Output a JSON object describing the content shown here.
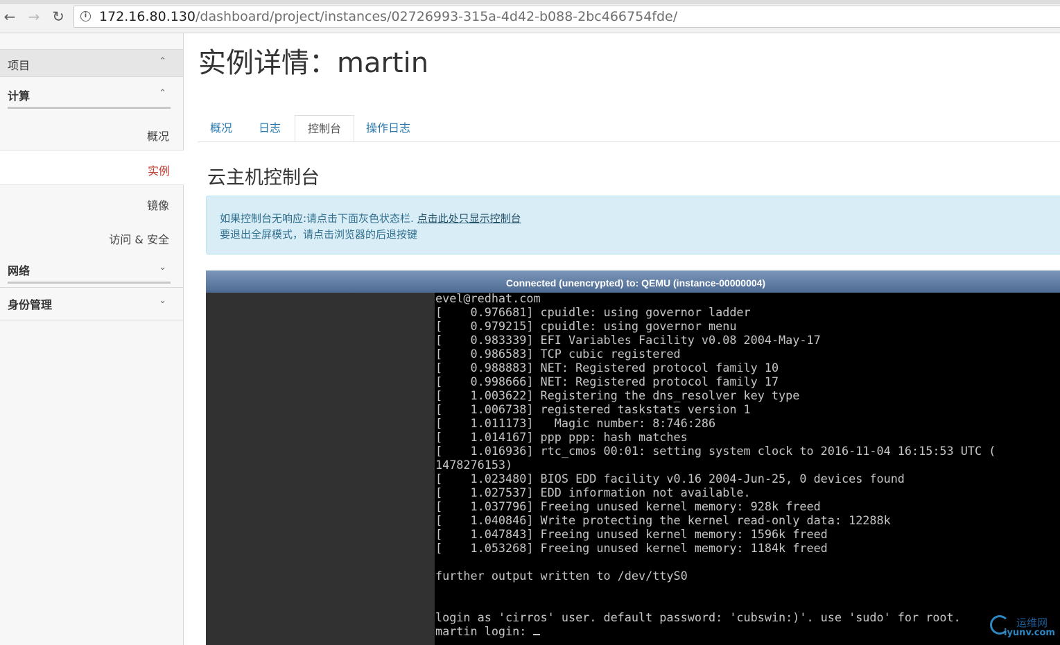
{
  "browser": {
    "url_host": "172.16.80.130",
    "url_path": "/dashboard/project/instances/02726993-315a-4d42-b088-2bc466754fde/"
  },
  "sidebar": {
    "project_label": "项目",
    "compute_label": "计算",
    "items": [
      {
        "label": "概况"
      },
      {
        "label": "实例"
      },
      {
        "label": "镜像"
      },
      {
        "label": "访问 & 安全"
      }
    ],
    "network_label": "网络",
    "identity_label": "身份管理"
  },
  "page": {
    "title": "实例详情：martin",
    "tabs": [
      {
        "label": "概况"
      },
      {
        "label": "日志"
      },
      {
        "label": "控制台"
      },
      {
        "label": "操作日志"
      }
    ],
    "section_title": "云主机控制台",
    "alert_text1": "如果控制台无响应:请点击下面灰色状态栏. ",
    "alert_link": "点击此处只显示控制台",
    "alert_text2": "要退出全屏模式，请点击浏览器的后退按键"
  },
  "console": {
    "status": "Connected (unencrypted) to: QEMU (instance-00000004)",
    "lines": [
      "evel@redhat.com",
      "[    0.976681] cpuidle: using governor ladder",
      "[    0.979215] cpuidle: using governor menu",
      "[    0.983339] EFI Variables Facility v0.08 2004-May-17",
      "[    0.986583] TCP cubic registered",
      "[    0.988883] NET: Registered protocol family 10",
      "[    0.998666] NET: Registered protocol family 17",
      "[    1.003622] Registering the dns_resolver key type",
      "[    1.006738] registered taskstats version 1",
      "[    1.011173]   Magic number: 8:746:286",
      "[    1.014167] ppp ppp: hash matches",
      "[    1.016936] rtc_cmos 00:01: setting system clock to 2016-11-04 16:15:53 UTC (",
      "1478276153)",
      "[    1.023480] BIOS EDD facility v0.16 2004-Jun-25, 0 devices found",
      "[    1.027537] EDD information not available.",
      "[    1.037796] Freeing unused kernel memory: 928k freed",
      "[    1.040846] Write protecting the kernel read-only data: 12288k",
      "[    1.047843] Freeing unused kernel memory: 1596k freed",
      "[    1.053268] Freeing unused kernel memory: 1184k freed",
      "",
      "further output written to /dev/ttyS0",
      "",
      "",
      "login as 'cirros' user. default password: 'cubswin:)'. use 'sudo' for root.",
      "martin login: "
    ]
  },
  "watermark": {
    "cn": "运维网",
    "en": "iyunv.com"
  }
}
